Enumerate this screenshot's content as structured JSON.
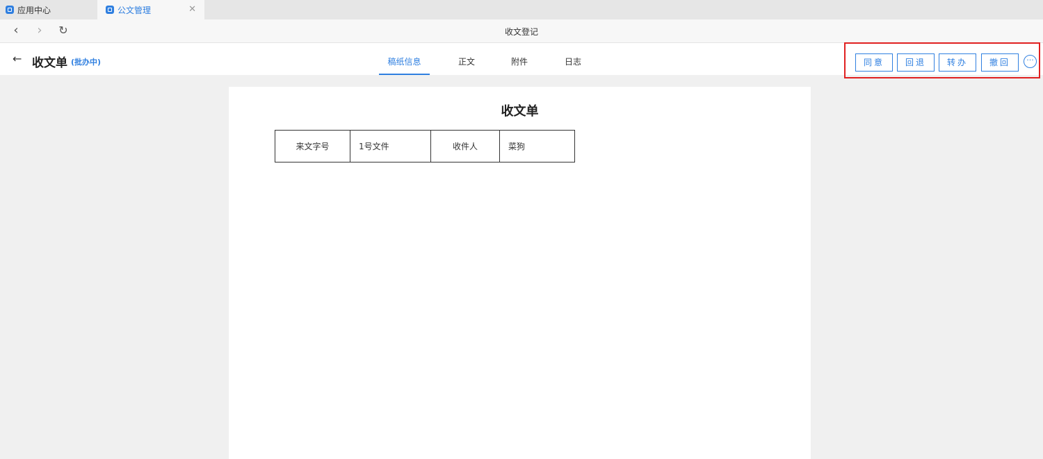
{
  "tabs": [
    {
      "label": "应用中心"
    },
    {
      "label": "公文管理"
    }
  ],
  "nav": {
    "title": "收文登记"
  },
  "header": {
    "title": "收文单",
    "status": "(批办中)",
    "tabs": [
      "稿纸信息",
      "正文",
      "附件",
      "日志"
    ],
    "active_tab": "稿纸信息",
    "actions": [
      "同意",
      "回退",
      "转办",
      "撤回"
    ],
    "more_icon": "ellipsis-circle-icon"
  },
  "form": {
    "title": "收文单",
    "fields": [
      {
        "label": "来文字号",
        "value": "1号文件"
      },
      {
        "label": "收件人",
        "value": "菜狗"
      }
    ]
  },
  "colors": {
    "accent": "#2f7fe0",
    "highlight_border": "#e02020"
  }
}
